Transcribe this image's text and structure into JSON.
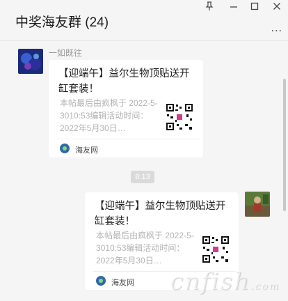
{
  "chat": {
    "title": "中奖海友群 (24)"
  },
  "window": {
    "pin_icon": "pin-icon",
    "minimize_icon": "minimize-icon",
    "maximize_icon": "maximize-icon",
    "close_icon": "close-icon",
    "more_label": "..."
  },
  "messages": [
    {
      "sender": "一如既往",
      "card": {
        "title": "【迎端午】益尔生物顶贴送开缸套装！",
        "desc": "本帖最后由疯枫于 2022-5-3010:53编辑活动时间：2022年5月30日…",
        "source": "海友网"
      }
    },
    {
      "sender": "",
      "card": {
        "title": "【迎端午】益尔生物顶贴送开缸套装！",
        "desc": "本帖最后由疯枫于 2022-5-3010:53编辑活动时间：2022年5月30日…",
        "source": "海友网"
      }
    }
  ],
  "timestamp": "8:13",
  "watermark": "cnfish",
  "watermark_sub": ".com"
}
